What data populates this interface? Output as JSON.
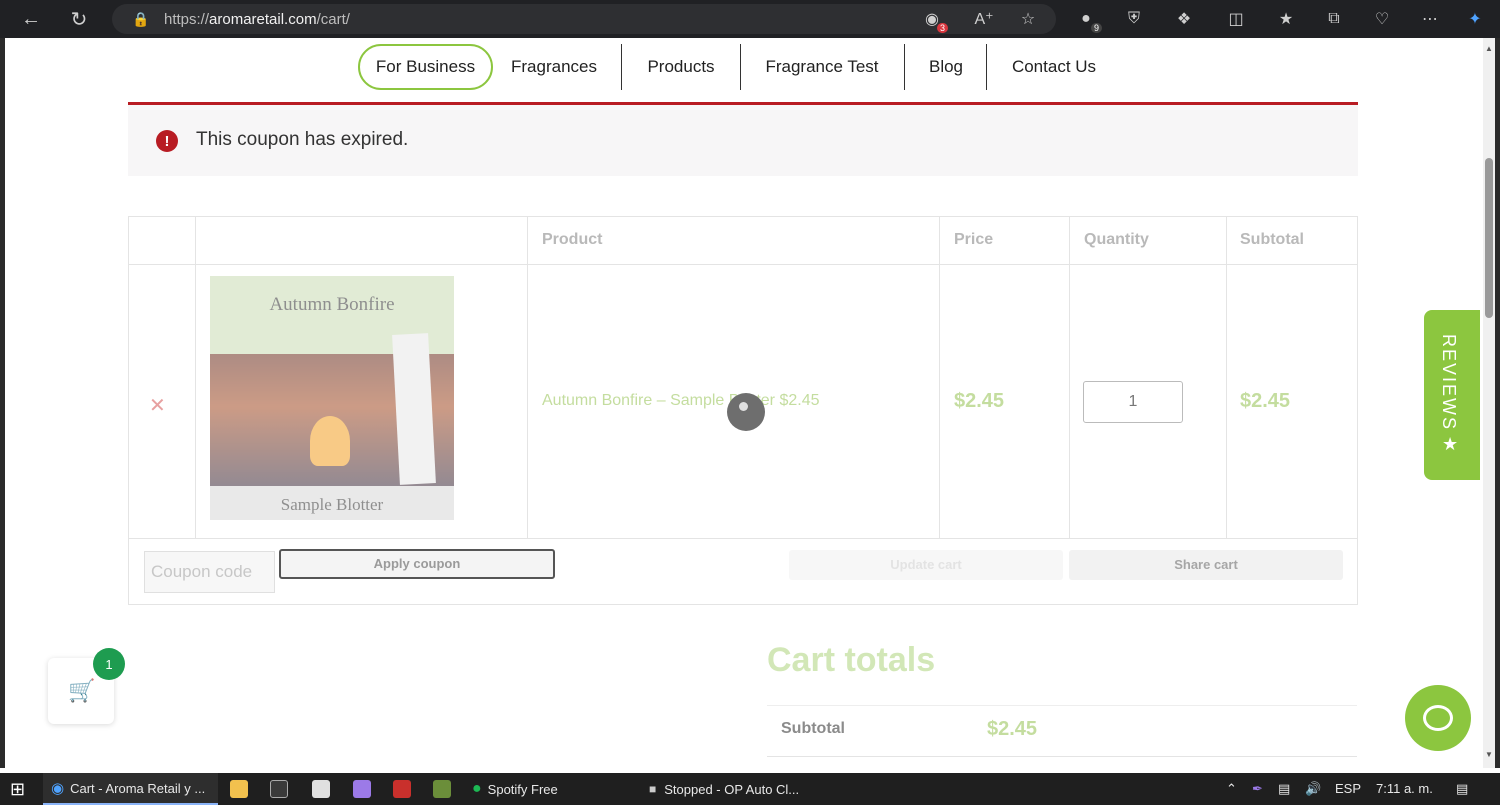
{
  "browser": {
    "url_prefix": "https://",
    "url_host": "aromaretail.com",
    "url_path": "/cart/",
    "ext_badge_1": "3",
    "ext_badge_2": "9"
  },
  "nav": {
    "items": [
      "For Business",
      "Fragrances",
      "Products",
      "Fragrance Test",
      "Blog",
      "Contact Us"
    ]
  },
  "notice": {
    "message": "This coupon has expired."
  },
  "cart": {
    "headers": {
      "product": "Product",
      "price": "Price",
      "quantity": "Quantity",
      "subtotal": "Subtotal"
    },
    "item": {
      "image_title": "Autumn Bonfire",
      "image_subtitle": "Sample Blotter",
      "name": "Autumn Bonfire – Sample Blotter $2.45",
      "price": "$2.45",
      "quantity": "1",
      "subtotal": "$2.45"
    },
    "coupon_placeholder": "Coupon code",
    "apply_label": "Apply coupon",
    "update_label": "Update cart",
    "share_label": "Share cart"
  },
  "totals": {
    "title": "Cart totals",
    "subtotal_label": "Subtotal",
    "subtotal_value": "$2.45"
  },
  "widgets": {
    "reviews_label": "REVIEWS",
    "reviews_star": "★",
    "cart_count": "1"
  },
  "taskbar": {
    "edge_tab": "Cart - Aroma Retail y ...",
    "spotify": "Spotify Free",
    "autoclicker": "Stopped - OP Auto Cl...",
    "lang": "ESP",
    "time": "7:11 a. m."
  },
  "colors": {
    "brand_green": "#8cc63f",
    "error_red": "#b81c23"
  }
}
